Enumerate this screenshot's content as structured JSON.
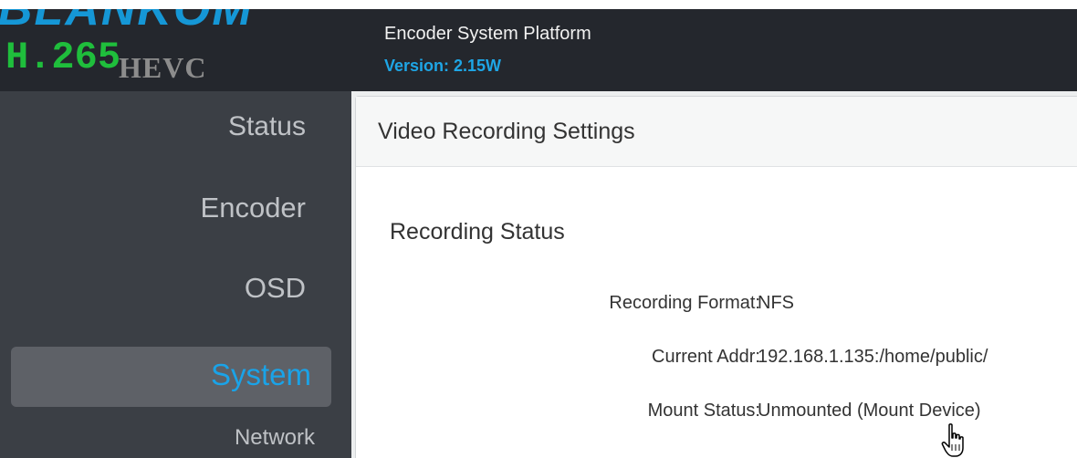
{
  "header": {
    "logo_brand": "BLANKOM",
    "logo_codec": "H.265",
    "logo_suffix": "HEVC",
    "platform_name": "Encoder System Platform",
    "version": "Version: 2.15W"
  },
  "sidebar": {
    "items": [
      {
        "label": "Status"
      },
      {
        "label": "Encoder"
      },
      {
        "label": "OSD"
      },
      {
        "label": "System",
        "active": true
      },
      {
        "label": "Network"
      }
    ]
  },
  "panel": {
    "title": "Video Recording Settings",
    "section_title": "Recording Status",
    "fields": [
      {
        "label": "Recording Format:",
        "value": "NFS"
      },
      {
        "label": "Current Addr:",
        "value": "192.168.1.135:/home/public/"
      },
      {
        "label": "Mount Status:",
        "value": "Unmounted",
        "action": "(Mount Device)"
      }
    ]
  },
  "colors": {
    "header_bg": "#24272d",
    "sidebar_bg": "#3b3f45",
    "active_item_bg": "#5e6167",
    "accent": "#1aa3e8",
    "logo_green": "#1fbe3c"
  },
  "icons": {
    "cursor": "hand-pointer-icon"
  }
}
